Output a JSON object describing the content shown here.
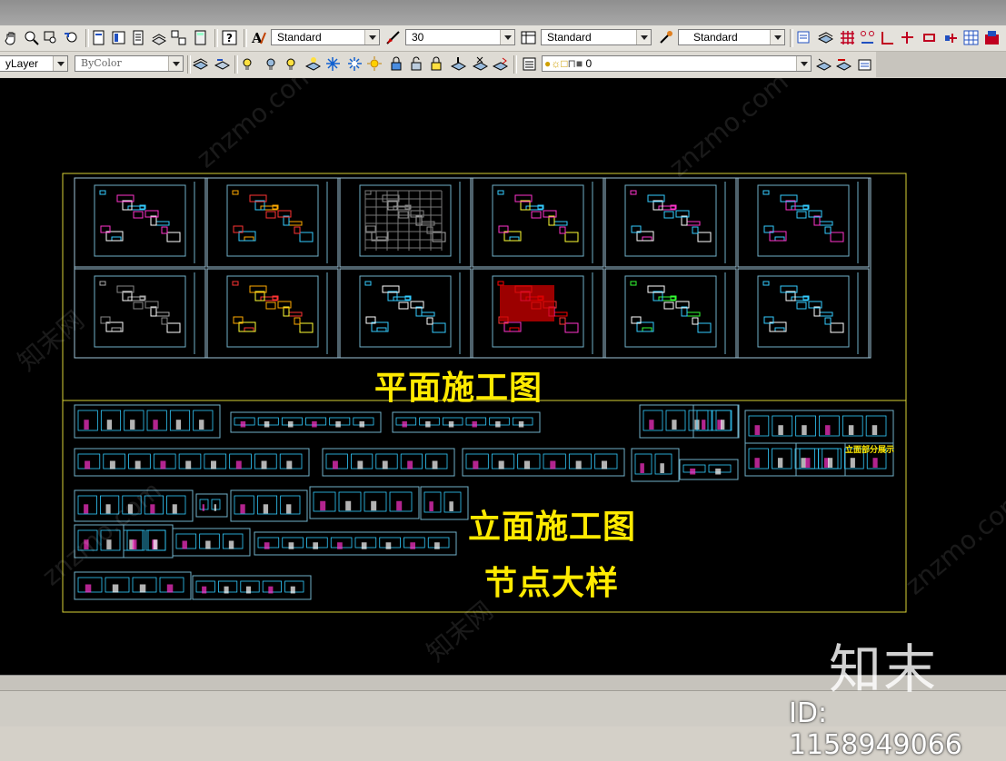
{
  "toolbar1": {
    "text_style": "Standard",
    "dim_scale": "30",
    "dim_style": "Standard",
    "table_style": "Standard"
  },
  "toolbar2": {
    "layer": "yLayer",
    "color": "ByColor",
    "layer_state": "0"
  },
  "drawing": {
    "title_plan": "平面施工图",
    "title_elev": "立面施工图",
    "title_detail": "节点大样",
    "note_partial": "立面部分展示"
  },
  "watermark": {
    "logo": "知末",
    "id_label": "ID: 1158949066",
    "site": "znzmo.com",
    "cn": "知末网"
  },
  "colors": {
    "cad_background": "#000000",
    "frame_yellow": "#d8d236",
    "title_yellow": "#ffea00",
    "sheet_cyan": "#6fb0c8"
  }
}
